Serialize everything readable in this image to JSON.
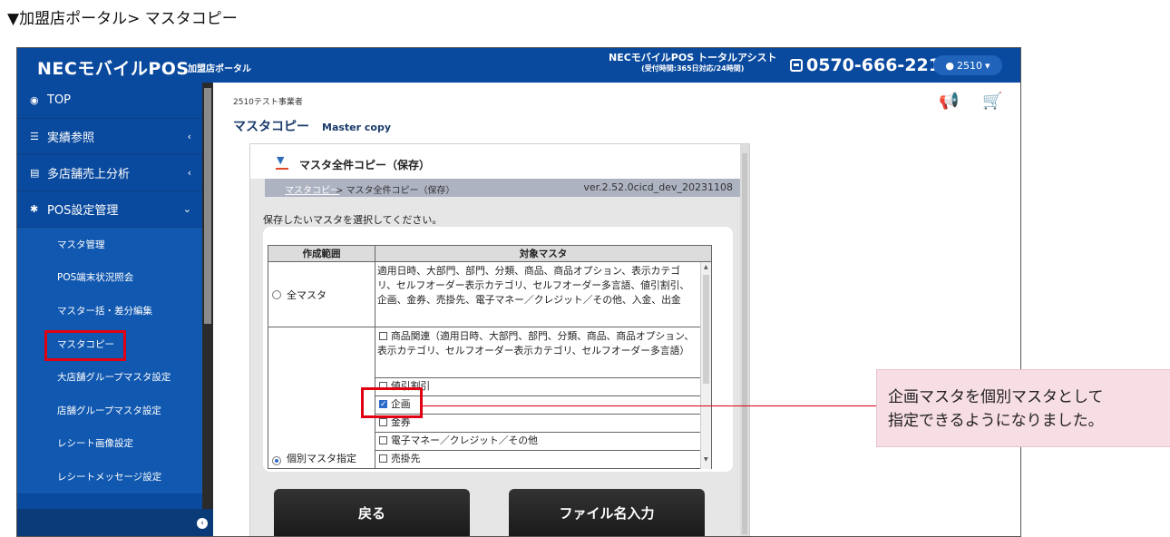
{
  "doc_heading": "▼加盟店ポータル> マスタコピー",
  "topbar": {
    "brand": "NECモバイルPOS",
    "portal": "加盟店ポータル",
    "assist_title": "NECモバイルPOS トータルアシスト",
    "assist_hours": "(受付時間:365日対応/24時間)",
    "phone": "0570-666-221",
    "user": "2510"
  },
  "sidebar": {
    "items": [
      {
        "label": "TOP",
        "icon": "dashboard-icon"
      },
      {
        "label": "実績参照",
        "icon": "list-icon"
      },
      {
        "label": "多店舗売上分析",
        "icon": "database-icon"
      },
      {
        "label": "POS設定管理",
        "icon": "gear-icon"
      }
    ],
    "sub_items": [
      "マスタ管理",
      "POS端末状況照会",
      "マスター括・差分編集",
      "マスタコピー",
      "大店舗グループマスタ設定",
      "店舗グループマスタ設定",
      "レシート画像設定",
      "レシートメッセージ設定"
    ]
  },
  "main": {
    "company": "2510テスト事業者",
    "title": "マスタコピー",
    "title_en": "Master copy"
  },
  "panel": {
    "title": "マスタ全件コピー（保存）",
    "crumb_link": "マスタコピー",
    "crumb_rest": "> マスタ全件コピー（保存）",
    "version": "ver.2.52.0cicd_dev_20231108",
    "instruction": "保存したいマスタを選択してください。",
    "table": {
      "headers": [
        "作成範囲",
        "対象マスタ"
      ],
      "row1_label": "全マスタ",
      "row1_text": "適用日時、大部門、部門、分類、商品、商品オプション、表示カテゴリ、セルフオーダー表示カテゴリ、セルフオーダー多言語、値引割引、企画、金券、売掛先、電子マネー／クレジット／その他、入金、出金",
      "row2_label": "個別マスタ指定",
      "row2_items": [
        "商品関連（適用日時、大部門、部門、分類、商品、商品オプション、表示カテゴリ、セルフオーダー表示カテゴリ、セルフオーダー多言語）",
        "値引割引",
        "企画",
        "金券",
        "電子マネー／クレジット／その他",
        "売掛先"
      ]
    },
    "buttons": {
      "back": "戻る",
      "file": "ファイル名入力"
    }
  },
  "callout": {
    "line1": "企画マスタを個別マスタとして",
    "line2": "指定できるようになりました。"
  }
}
